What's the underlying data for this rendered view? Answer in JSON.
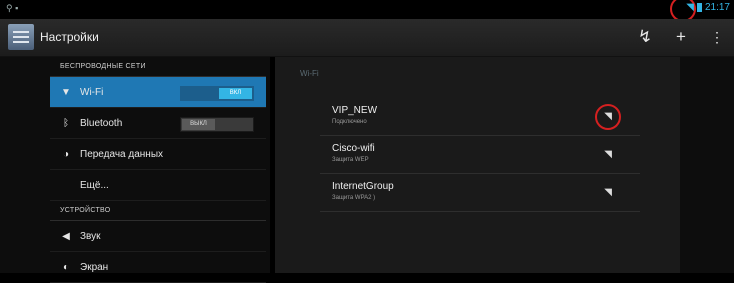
{
  "statusbar": {
    "left_icons": "⚲ ▪",
    "time": "21:17"
  },
  "actionbar": {
    "title": "Настройки"
  },
  "sidebar": {
    "sections": [
      {
        "header": "БЕСПРОВОДНЫЕ СЕТИ"
      },
      {
        "header": "УСТРОЙСТВО"
      }
    ],
    "items": [
      {
        "label": "Wi-Fi",
        "icon": "wifi-icon",
        "toggle": "ВКЛ"
      },
      {
        "label": "Bluetooth",
        "icon": "bluetooth-icon",
        "toggle": "ВЫКЛ"
      },
      {
        "label": "Передача данных",
        "icon": "data-usage-icon"
      },
      {
        "label": "Ещё..."
      },
      {
        "label": "Звук",
        "icon": "sound-icon"
      },
      {
        "label": "Экран",
        "icon": "display-icon"
      }
    ]
  },
  "wifi_panel": {
    "header": "Wi-Fi",
    "networks": [
      {
        "name": "VIP_NEW",
        "status": "Подключено"
      },
      {
        "name": "Cisco-wifi",
        "status": "Защита WEP"
      },
      {
        "name": "InternetGroup",
        "status": "Защита WPA2 )"
      }
    ]
  }
}
